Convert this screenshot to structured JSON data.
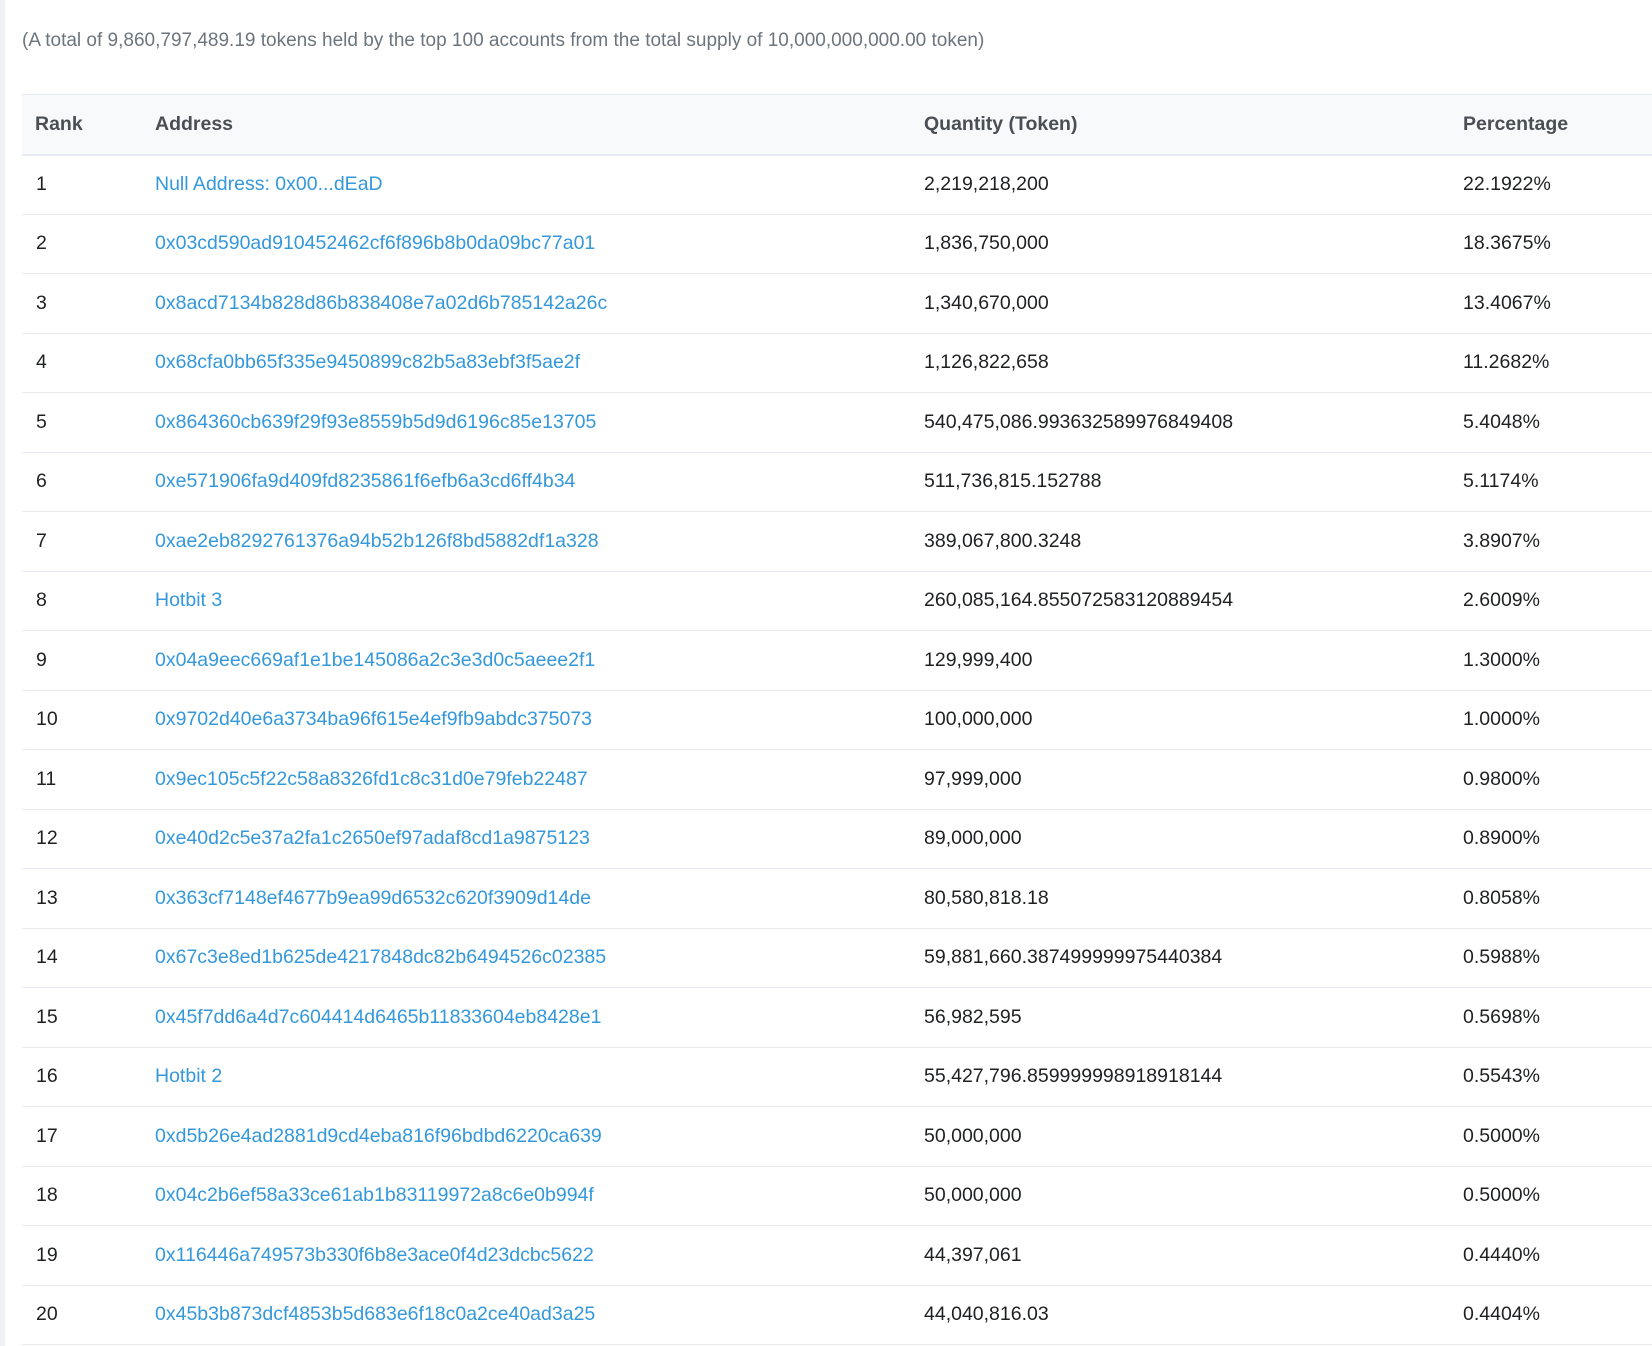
{
  "summary": "(A total of 9,860,797,489.19 tokens held by the top 100 accounts from the total supply of 10,000,000,000.00 token)",
  "table": {
    "headers": {
      "rank": "Rank",
      "address": "Address",
      "quantity": "Quantity (Token)",
      "percentage": "Percentage"
    },
    "rows": [
      {
        "rank": "1",
        "address": "Null Address: 0x00...dEaD",
        "quantity": "2,219,218,200",
        "percentage": "22.1922%"
      },
      {
        "rank": "2",
        "address": "0x03cd590ad910452462cf6f896b8b0da09bc77a01",
        "quantity": "1,836,750,000",
        "percentage": "18.3675%"
      },
      {
        "rank": "3",
        "address": "0x8acd7134b828d86b838408e7a02d6b785142a26c",
        "quantity": "1,340,670,000",
        "percentage": "13.4067%"
      },
      {
        "rank": "4",
        "address": "0x68cfa0bb65f335e9450899c82b5a83ebf3f5ae2f",
        "quantity": "1,126,822,658",
        "percentage": "11.2682%"
      },
      {
        "rank": "5",
        "address": "0x864360cb639f29f93e8559b5d9d6196c85e13705",
        "quantity": "540,475,086.99363258997684940‌8",
        "percentage": "5.4048%"
      },
      {
        "rank": "6",
        "address": "0xe571906fa9d409fd8235861f6efb6a3cd6ff4b34",
        "quantity": "511,736,815.152788",
        "percentage": "5.1174%"
      },
      {
        "rank": "7",
        "address": "0xae2eb8292761376a94b52b126f8bd5882df1a328",
        "quantity": "389,067,800.3248",
        "percentage": "3.8907%"
      },
      {
        "rank": "8",
        "address": "Hotbit 3",
        "quantity": "260,085,164.855072583120889454",
        "percentage": "2.6009%"
      },
      {
        "rank": "9",
        "address": "0x04a9eec669af1e1be145086a2c3e3d0c5aeee2f1",
        "quantity": "129,999,400",
        "percentage": "1.3000%"
      },
      {
        "rank": "10",
        "address": "0x9702d40e6a3734ba96f615e4ef9fb9abdc375073",
        "quantity": "100,000,000",
        "percentage": "1.0000%"
      },
      {
        "rank": "11",
        "address": "0x9ec105c5f22c58a8326fd1c8c31d0e79feb22487",
        "quantity": "97,999,000",
        "percentage": "0.9800%"
      },
      {
        "rank": "12",
        "address": "0xe40d2c5e37a2fa1c2650ef97adaf8cd1a9875123",
        "quantity": "89,000,000",
        "percentage": "0.8900%"
      },
      {
        "rank": "13",
        "address": "0x363cf7148ef4677b9ea99d6532c620f3909d14de",
        "quantity": "80,580,818.18",
        "percentage": "0.8058%"
      },
      {
        "rank": "14",
        "address": "0x67c3e8ed1b625de4217848dc82b6494526c02385",
        "quantity": "59,881,660.387499999975440384",
        "percentage": "0.5988%"
      },
      {
        "rank": "15",
        "address": "0x45f7dd6a4d7c604414d6465b11833604eb8428e1",
        "quantity": "56,982,595",
        "percentage": "0.5698%"
      },
      {
        "rank": "16",
        "address": "Hotbit 2",
        "quantity": "55,427,796.859999998918918144",
        "percentage": "0.5543%"
      },
      {
        "rank": "17",
        "address": "0xd5b26e4ad2881d9cd4eba816f96bdbd6220ca639",
        "quantity": "50,000,000",
        "percentage": "0.5000%"
      },
      {
        "rank": "18",
        "address": "0x04c2b6ef58a33ce61ab1b83119972a8c6e0b994f",
        "quantity": "50,000,000",
        "percentage": "0.5000%"
      },
      {
        "rank": "19",
        "address": "0x116446a749573b330f6b8e3ace0f4d23dcbc5622",
        "quantity": "44,397,061",
        "percentage": "0.4440%"
      },
      {
        "rank": "20",
        "address": "0x45b3b873dcf4853b5d683e6f18c0a2ce40ad3a25",
        "quantity": "44,040,816.03",
        "percentage": "0.4404%"
      }
    ]
  },
  "colors": {
    "link": "#3498db",
    "header_bg": "#f8f9fa",
    "border": "#e7eaf3",
    "muted_text": "#6c757d"
  }
}
